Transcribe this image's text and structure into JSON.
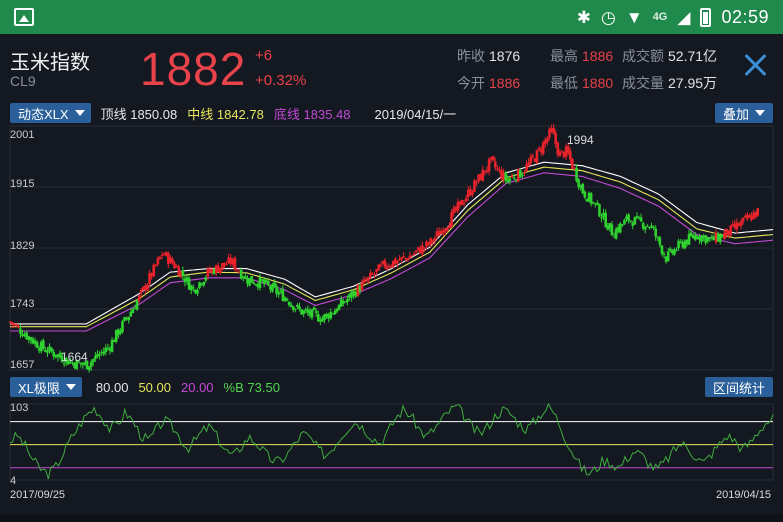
{
  "statusbar": {
    "time": "02:59",
    "network": "4G"
  },
  "header": {
    "title": "玉米指数",
    "code": "CL9",
    "price": "1882",
    "change": "+6",
    "change_pct": "+0.32%",
    "stats": {
      "prev_close_label": "昨收",
      "prev_close": "1876",
      "open_label": "今开",
      "open": "1886",
      "high_label": "最高",
      "high": "1886",
      "low_label": "最低",
      "low": "1880",
      "turnover_label": "成交额",
      "turnover": "52.71亿",
      "volume_label": "成交量",
      "volume": "27.95万"
    }
  },
  "main_indicator": {
    "dropdown": "动态XLX",
    "top_label": "顶线",
    "top_value": "1850.08",
    "mid_label": "中线",
    "mid_value": "1842.78",
    "bot_label": "底线",
    "bot_value": "1835.48",
    "date": "2019/04/15/一",
    "overlay_button": "叠加"
  },
  "sub_indicator": {
    "dropdown": "XL极限",
    "v1": "80.00",
    "v2": "50.00",
    "v3": "20.00",
    "pb_label": "%B",
    "pb_value": "73.50",
    "stats_button": "区间统计"
  },
  "colors": {
    "up": "#e8232b",
    "down": "#2fd22f",
    "top_line": "#ffffff",
    "mid_line": "#e6e65a",
    "bot_line": "#c24ad6",
    "accent": "#2a5f9a"
  },
  "chart_data": [
    {
      "type": "candlestick",
      "yticks": [
        "2001",
        "1915",
        "1829",
        "1743",
        "1657"
      ],
      "ylim": [
        1657,
        2001
      ],
      "annotations": [
        {
          "label": "1994",
          "value": 1994,
          "kind": "high"
        },
        {
          "label": "1664",
          "value": 1664,
          "kind": "low"
        }
      ],
      "price_path": [
        [
          0,
          1725
        ],
        [
          4,
          1690
        ],
        [
          8,
          1668
        ],
        [
          10,
          1664
        ],
        [
          13,
          1690
        ],
        [
          17,
          1760
        ],
        [
          20,
          1822
        ],
        [
          22,
          1800
        ],
        [
          24,
          1770
        ],
        [
          26,
          1795
        ],
        [
          29,
          1810
        ],
        [
          31,
          1785
        ],
        [
          33,
          1780
        ],
        [
          36,
          1760
        ],
        [
          38,
          1740
        ],
        [
          41,
          1730
        ],
        [
          43,
          1745
        ],
        [
          46,
          1775
        ],
        [
          49,
          1805
        ],
        [
          52,
          1815
        ],
        [
          55,
          1835
        ],
        [
          57,
          1860
        ],
        [
          59,
          1890
        ],
        [
          61,
          1920
        ],
        [
          63,
          1950
        ],
        [
          65,
          1925
        ],
        [
          67,
          1935
        ],
        [
          69,
          1960
        ],
        [
          71,
          1994
        ],
        [
          72,
          1960
        ],
        [
          73,
          1965
        ],
        [
          75,
          1910
        ],
        [
          77,
          1885
        ],
        [
          79,
          1850
        ],
        [
          81,
          1870
        ],
        [
          84,
          1860
        ],
        [
          86,
          1815
        ],
        [
          88,
          1835
        ],
        [
          90,
          1848
        ],
        [
          92,
          1840
        ],
        [
          94,
          1850
        ],
        [
          96,
          1865
        ],
        [
          98,
          1880
        ]
      ],
      "bands": {
        "top": [
          [
            0,
            1722
          ],
          [
            10,
            1722
          ],
          [
            17,
            1765
          ],
          [
            21,
            1795
          ],
          [
            26,
            1800
          ],
          [
            31,
            1800
          ],
          [
            36,
            1785
          ],
          [
            40,
            1760
          ],
          [
            45,
            1775
          ],
          [
            50,
            1800
          ],
          [
            55,
            1830
          ],
          [
            60,
            1890
          ],
          [
            65,
            1935
          ],
          [
            70,
            1950
          ],
          [
            75,
            1945
          ],
          [
            80,
            1930
          ],
          [
            85,
            1905
          ],
          [
            90,
            1865
          ],
          [
            95,
            1850
          ],
          [
            100,
            1855
          ]
        ],
        "mid": [
          [
            0,
            1718
          ],
          [
            10,
            1718
          ],
          [
            17,
            1758
          ],
          [
            21,
            1788
          ],
          [
            26,
            1795
          ],
          [
            31,
            1794
          ],
          [
            36,
            1778
          ],
          [
            40,
            1755
          ],
          [
            45,
            1770
          ],
          [
            50,
            1794
          ],
          [
            55,
            1823
          ],
          [
            60,
            1882
          ],
          [
            65,
            1928
          ],
          [
            70,
            1943
          ],
          [
            75,
            1938
          ],
          [
            80,
            1922
          ],
          [
            85,
            1897
          ],
          [
            90,
            1856
          ],
          [
            95,
            1843
          ],
          [
            100,
            1848
          ]
        ],
        "bot": [
          [
            0,
            1712
          ],
          [
            10,
            1712
          ],
          [
            17,
            1750
          ],
          [
            21,
            1780
          ],
          [
            26,
            1787
          ],
          [
            31,
            1787
          ],
          [
            36,
            1770
          ],
          [
            40,
            1748
          ],
          [
            45,
            1763
          ],
          [
            50,
            1786
          ],
          [
            55,
            1815
          ],
          [
            60,
            1873
          ],
          [
            65,
            1920
          ],
          [
            70,
            1935
          ],
          [
            75,
            1930
          ],
          [
            80,
            1913
          ],
          [
            85,
            1888
          ],
          [
            90,
            1848
          ],
          [
            95,
            1835
          ],
          [
            100,
            1840
          ]
        ]
      }
    },
    {
      "type": "line",
      "yticks": [
        "103",
        "4"
      ],
      "ylim": [
        4,
        103
      ],
      "hlines": [
        80,
        50,
        20
      ],
      "x_start": "2017/09/25",
      "x_end": "2019/04/15",
      "values": [
        55,
        62,
        48,
        30,
        18,
        12,
        22,
        40,
        60,
        75,
        90,
        98,
        85,
        70,
        78,
        92,
        80,
        62,
        55,
        70,
        82,
        74,
        60,
        45,
        55,
        68,
        74,
        58,
        42,
        35,
        48,
        60,
        52,
        40,
        30,
        28,
        38,
        52,
        65,
        58,
        44,
        36,
        48,
        62,
        74,
        80,
        70,
        60,
        52,
        66,
        84,
        96,
        88,
        72,
        60,
        70,
        82,
        94,
        100,
        86,
        72,
        64,
        74,
        88,
        96,
        90,
        78,
        70,
        80,
        92,
        100,
        84,
        60,
        40,
        22,
        12,
        18,
        30,
        26,
        20,
        32,
        42,
        36,
        24,
        18,
        28,
        40,
        52,
        46,
        34,
        26,
        38,
        50,
        62,
        56,
        44,
        52,
        66,
        78,
        84
      ]
    }
  ]
}
